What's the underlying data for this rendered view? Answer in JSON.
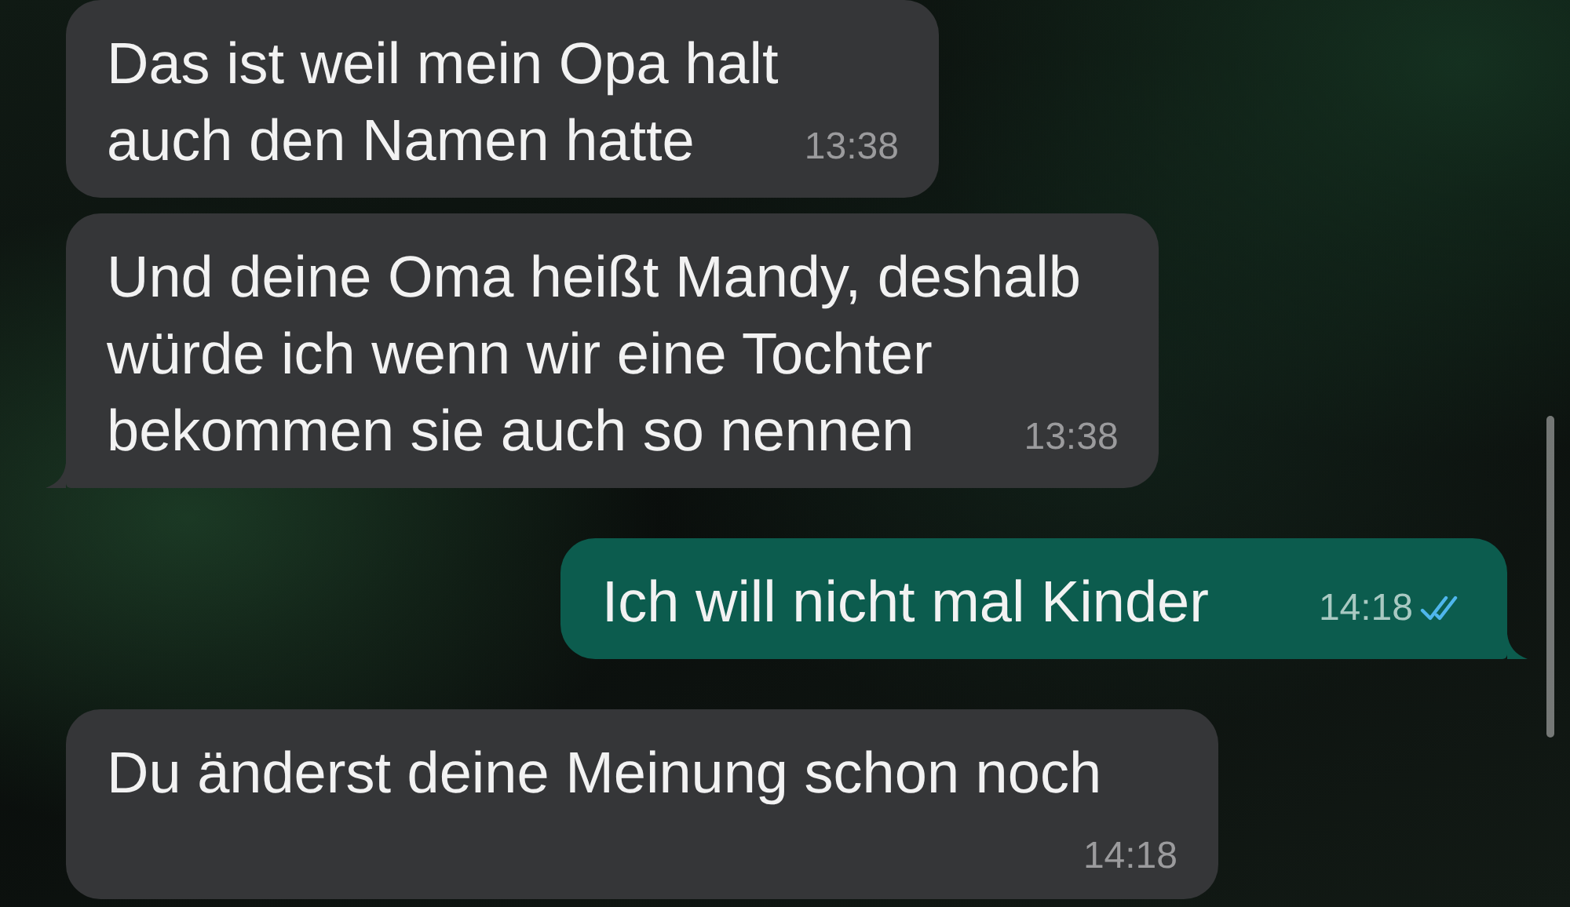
{
  "messages": [
    {
      "lines": [
        "Das ist weil mein Opa halt",
        "auch den Namen hatte"
      ],
      "time": "13:38",
      "outgoing": false,
      "tail": false
    },
    {
      "lines": [
        "Und deine Oma heißt Mandy, deshalb",
        "würde ich wenn wir eine Tochter",
        "bekommen sie auch so nennen"
      ],
      "time": "13:38",
      "outgoing": false,
      "tail": true
    },
    {
      "lines": [
        "Ich will nicht mal Kinder"
      ],
      "time": "14:18",
      "outgoing": true,
      "tail": true,
      "read": true
    },
    {
      "lines": [
        "Du änderst deine Meinung schon noch"
      ],
      "time": "14:18",
      "outgoing": false,
      "tail": false
    }
  ]
}
